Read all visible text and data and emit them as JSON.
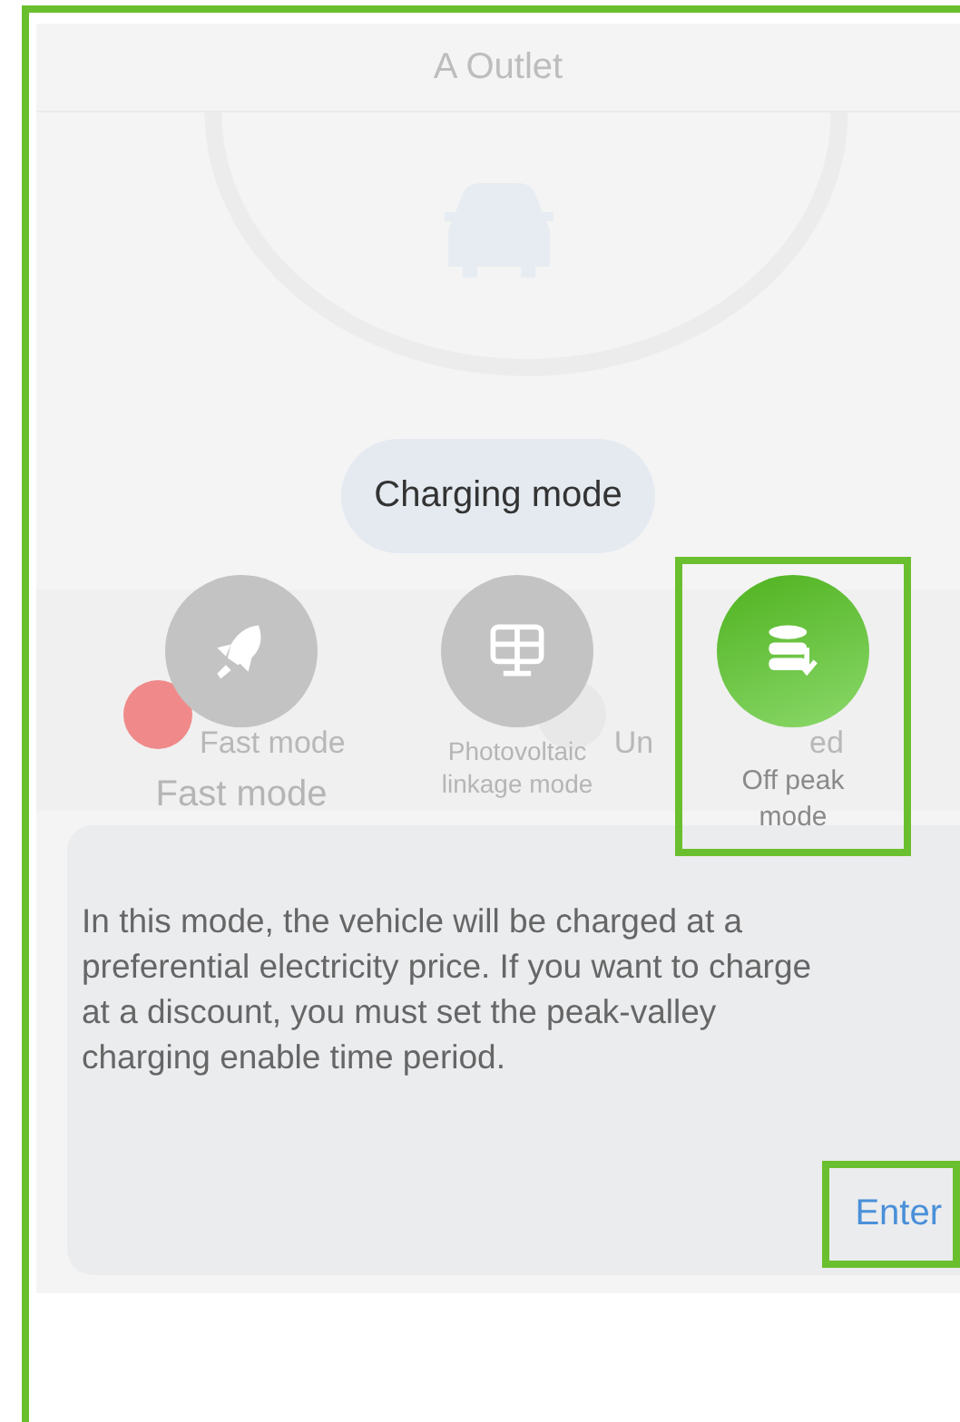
{
  "header": {
    "title": "A Outlet"
  },
  "background_modes": [
    {
      "label_start": "Fast mode",
      "color": "#f08a8a"
    },
    {
      "label_start": "Un",
      "label_end": "ed",
      "color": "#e8e8e8"
    }
  ],
  "dialog": {
    "title": "Charging mode",
    "modes": [
      {
        "kind": "rocket",
        "label": "Fast mode",
        "selected": false,
        "highlighted": false
      },
      {
        "kind": "solar",
        "label": "Photovoltaic linkage mode",
        "selected": false,
        "highlighted": false
      },
      {
        "kind": "database",
        "label": "Off peak mode",
        "selected": true,
        "highlighted": true
      }
    ],
    "description": "In this mode, the vehicle will be charged at a preferential electricity price. If you want to charge at a discount, you must set the peak-valley charging enable time period.",
    "enter_button": {
      "label": "Enter",
      "highlighted": true
    }
  }
}
